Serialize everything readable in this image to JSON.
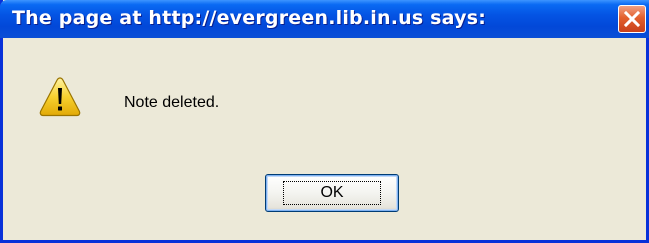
{
  "dialog": {
    "title": "The page at http://evergreen.lib.in.us says:",
    "message": "Note deleted.",
    "ok_label": "OK"
  },
  "icons": {
    "close": "close-icon",
    "warning": "warning-icon"
  },
  "colors": {
    "titlebar": "#0453e3",
    "frame_border": "#0831d9",
    "dialog_background": "#ece9d8",
    "close_button": "#e3602d",
    "warning_yellow": "#f7d12f",
    "button_border": "#003c74"
  }
}
